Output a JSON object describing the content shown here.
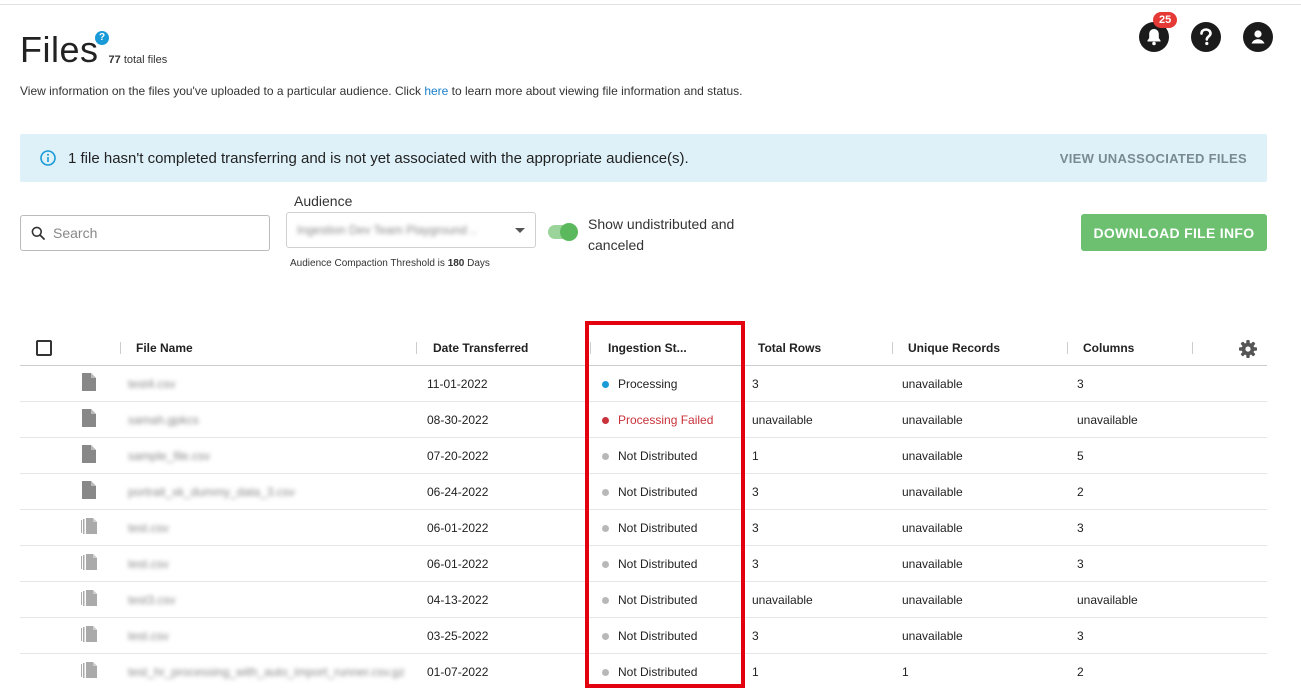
{
  "header": {
    "title": "Files",
    "help_icon": "question-circle-icon",
    "help_glyph": "?",
    "total_count": "77",
    "total_label": "total files",
    "description_before": "View information on the files you've uploaded to a particular audience. Click ",
    "description_link": "here",
    "description_after": " to learn more about viewing file information and status.",
    "notification_count": "25"
  },
  "banner": {
    "message": "1 file hasn't completed transferring and is not yet associated with the appropriate audience(s).",
    "link_label": "VIEW UNASSOCIATED FILES"
  },
  "controls": {
    "search_placeholder": "Search",
    "audience_label": "Audience",
    "audience_value": "Ingestion Dev Team Playground ..",
    "threshold_prefix": "Audience Compaction Threshold is ",
    "threshold_value": "180",
    "threshold_suffix": " Days",
    "toggle_label": "Show undistributed and canceled",
    "toggle_on": true,
    "download_label": "DOWNLOAD FILE INFO"
  },
  "table": {
    "columns": [
      "File Name",
      "Date Transferred",
      "Ingestion St...",
      "Total Rows",
      "Unique Records",
      "Columns"
    ],
    "rows": [
      {
        "file_name": "test4.csv",
        "date": "11-01-2022",
        "status": "Processing",
        "status_color": "#1a9ad6",
        "total_rows": "3",
        "unique_records": "unavailable",
        "columns": "3",
        "icon": "single-file-icon"
      },
      {
        "file_name": "samah.gpkcs",
        "date": "08-30-2022",
        "status": "Processing Failed",
        "status_color": "#c8323a",
        "total_rows": "unavailable",
        "unique_records": "unavailable",
        "columns": "unavailable",
        "icon": "single-file-icon"
      },
      {
        "file_name": "sample_file.csv",
        "date": "07-20-2022",
        "status": "Not Distributed",
        "status_color": "#b8b8b8",
        "total_rows": "1",
        "unique_records": "unavailable",
        "columns": "5",
        "icon": "single-file-icon"
      },
      {
        "file_name": "portrait_xk_dummy_data_3.csv",
        "date": "06-24-2022",
        "status": "Not Distributed",
        "status_color": "#b8b8b8",
        "total_rows": "3",
        "unique_records": "unavailable",
        "columns": "2",
        "icon": "single-file-icon"
      },
      {
        "file_name": "test.csv",
        "date": "06-01-2022",
        "status": "Not Distributed",
        "status_color": "#b8b8b8",
        "total_rows": "3",
        "unique_records": "unavailable",
        "columns": "3",
        "icon": "multi-file-icon"
      },
      {
        "file_name": "test.csv",
        "date": "06-01-2022",
        "status": "Not Distributed",
        "status_color": "#b8b8b8",
        "total_rows": "3",
        "unique_records": "unavailable",
        "columns": "3",
        "icon": "multi-file-icon"
      },
      {
        "file_name": "test3.csv",
        "date": "04-13-2022",
        "status": "Not Distributed",
        "status_color": "#b8b8b8",
        "total_rows": "unavailable",
        "unique_records": "unavailable",
        "columns": "unavailable",
        "icon": "multi-file-icon"
      },
      {
        "file_name": "test.csv",
        "date": "03-25-2022",
        "status": "Not Distributed",
        "status_color": "#b8b8b8",
        "total_rows": "3",
        "unique_records": "unavailable",
        "columns": "3",
        "icon": "multi-file-icon"
      },
      {
        "file_name": "test_hr_processing_with_auto_import_runner.csv.gz",
        "date": "01-07-2022",
        "status": "Not Distributed",
        "status_color": "#b8b8b8",
        "total_rows": "1",
        "unique_records": "1",
        "columns": "2",
        "icon": "multi-file-icon"
      }
    ]
  },
  "colors": {
    "accent_blue": "#1a9ad6",
    "success_green": "#6cc070",
    "error_red": "#c8323a",
    "highlight_red": "#e3000f",
    "banner_bg": "#def1f9"
  }
}
